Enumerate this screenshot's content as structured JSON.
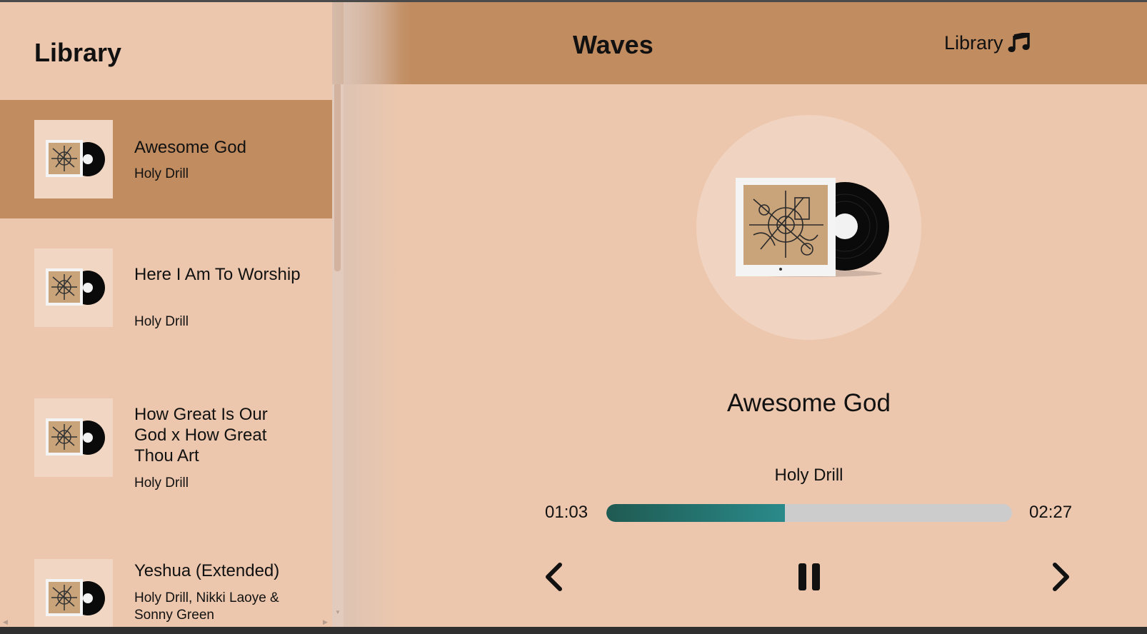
{
  "sidebar": {
    "title": "Library",
    "songs": [
      {
        "title": "Awesome God",
        "artist": "Holy Drill",
        "active": true
      },
      {
        "title": "Here I Am To Worship",
        "artist": "Holy Drill",
        "active": false
      },
      {
        "title": "How Great Is Our God x How Great Thou Art",
        "artist": "Holy Drill",
        "active": false
      },
      {
        "title": "Yeshua (Extended)",
        "artist": "Holy Drill, Nikki Laoye & Sonny Green",
        "active": false
      }
    ]
  },
  "header": {
    "app_title": "Waves",
    "library_button_label": "Library",
    "library_icon": "music-note-icon"
  },
  "player": {
    "title": "Awesome God",
    "artist": "Holy Drill",
    "current_time": "01:03",
    "total_time": "02:27",
    "progress_fraction": 0.44,
    "controls": [
      "prev-icon",
      "pause-icon",
      "next-icon"
    ]
  },
  "colors": {
    "background": "#ecc7ad",
    "accent": "#c18c60",
    "progress_start": "#1f5a52",
    "progress_end": "#2a8a8a",
    "track": "#cccccc"
  }
}
